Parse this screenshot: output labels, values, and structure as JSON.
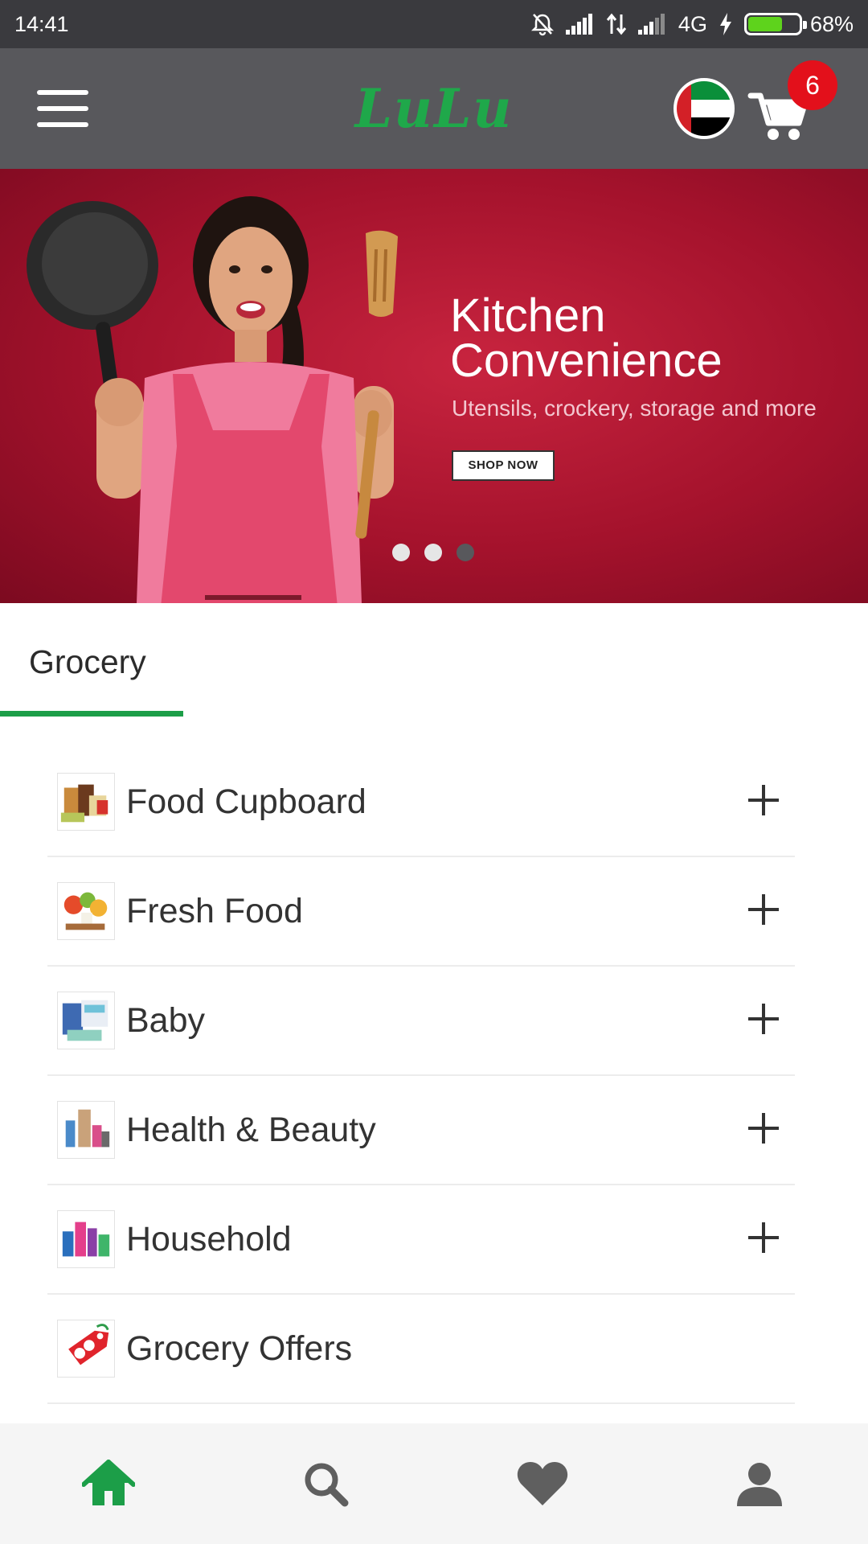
{
  "status_bar": {
    "time": "14:41",
    "network": "4G",
    "battery_percent": "68%",
    "battery_level": 0.68
  },
  "app_bar": {
    "logo_text": "LuLu",
    "cart_count": "6",
    "accent_color": "#1fa84a"
  },
  "banner": {
    "title_line1": "Kitchen",
    "title_line2": "Convenience",
    "subtitle": "Utensils, crockery, storage and more",
    "cta_label": "SHOP NOW",
    "slide_count": 3,
    "active_slide": 3
  },
  "tabs": [
    {
      "label": "Grocery",
      "active": true
    }
  ],
  "categories": [
    {
      "label": "Food Cupboard",
      "expandable": true,
      "icon": "food-cupboard-thumbnail"
    },
    {
      "label": "Fresh Food",
      "expandable": true,
      "icon": "fresh-food-thumbnail"
    },
    {
      "label": "Baby",
      "expandable": true,
      "icon": "baby-thumbnail"
    },
    {
      "label": "Health & Beauty",
      "expandable": true,
      "icon": "health-beauty-thumbnail"
    },
    {
      "label": "Household",
      "expandable": true,
      "icon": "household-thumbnail"
    },
    {
      "label": "Grocery Offers",
      "expandable": false,
      "icon": "offer-tag-thumbnail"
    }
  ],
  "bottom_nav": [
    {
      "icon": "home-icon",
      "active": true
    },
    {
      "icon": "search-icon",
      "active": false
    },
    {
      "icon": "heart-icon",
      "active": false
    },
    {
      "icon": "user-icon",
      "active": false
    }
  ],
  "colors": {
    "status_bar": "#3a3a3e",
    "app_bar": "#58585c",
    "banner": "#a4122c",
    "badge": "#e3101b",
    "active_green": "#1c9e48",
    "inactive_icon": "#5f5f5f"
  }
}
